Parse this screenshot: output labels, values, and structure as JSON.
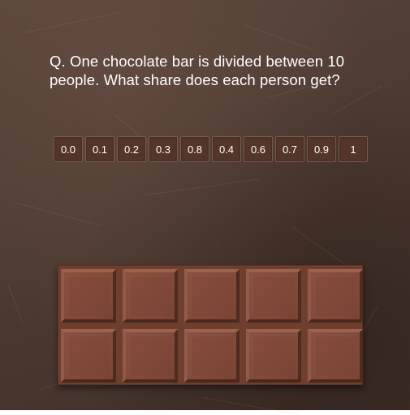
{
  "question": {
    "line1": "Q. One chocolate bar is divided between 10",
    "line2": "people. What share does each person get?"
  },
  "choices": [
    "0.0",
    "0.1",
    "0.2",
    "0.3",
    "0.8",
    "0.4",
    "0.6",
    "0.7",
    "0.9",
    "1"
  ],
  "chocolate": {
    "rows": 2,
    "columns": 5,
    "pieces": 10
  },
  "colors": {
    "background": "#4d3b32",
    "choice_box": "#54352b",
    "chocolate": "#7b4534",
    "text": "#ffffff"
  }
}
